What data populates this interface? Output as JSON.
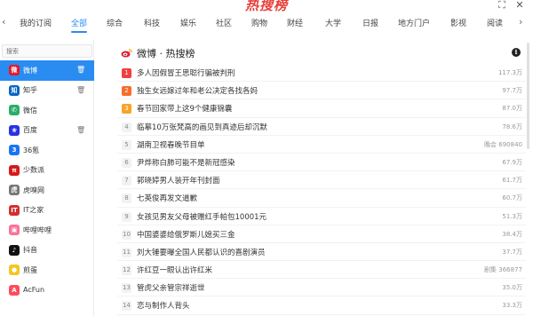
{
  "app": {
    "title": "热搜榜",
    "expand_icon": "⛶",
    "close_icon": "✕"
  },
  "tabs": {
    "prev_icon": "‹",
    "next_icon": "›",
    "items": [
      "我的订阅",
      "全部",
      "综合",
      "科技",
      "娱乐",
      "社区",
      "购物",
      "财经",
      "大学",
      "日报",
      "地方门户",
      "影视",
      "阅读"
    ],
    "active": "全部"
  },
  "sidebar": {
    "search_placeholder": "搜索",
    "items": [
      {
        "label": "微博",
        "icon": "weibo-icon",
        "glyph": "微",
        "color": "#e6162d",
        "active": true,
        "deletable": true
      },
      {
        "label": "知乎",
        "icon": "zhihu-icon",
        "glyph": "知",
        "color": "#0a66c2",
        "active": false,
        "deletable": true
      },
      {
        "label": "微信",
        "icon": "wechat-icon",
        "glyph": "✆",
        "color": "#2aae67",
        "active": false,
        "deletable": false
      },
      {
        "label": "百度",
        "icon": "baidu-icon",
        "glyph": "❀",
        "color": "#2932e1",
        "active": false,
        "deletable": true
      },
      {
        "label": "36氪",
        "icon": "36kr-icon",
        "glyph": "3",
        "color": "#1976f2",
        "active": false,
        "deletable": false
      },
      {
        "label": "少数派",
        "icon": "sspai-icon",
        "glyph": "π",
        "color": "#d71a1b",
        "active": false,
        "deletable": false
      },
      {
        "label": "虎嗅网",
        "icon": "huxiu-icon",
        "glyph": "虎",
        "color": "#777777",
        "active": false,
        "deletable": false
      },
      {
        "label": "IT之家",
        "icon": "ithome-icon",
        "glyph": "IT",
        "color": "#d32f2f",
        "active": false,
        "deletable": false
      },
      {
        "label": "哔哩哔哩",
        "icon": "bilibili-icon",
        "glyph": "▣",
        "color": "#fb7299",
        "active": false,
        "deletable": false
      },
      {
        "label": "抖音",
        "icon": "douyin-icon",
        "glyph": "♪",
        "color": "#111111",
        "active": false,
        "deletable": false
      },
      {
        "label": "煎蛋",
        "icon": "jandan-icon",
        "glyph": "●",
        "color": "#f3c623",
        "active": false,
        "deletable": false
      },
      {
        "label": "AcFun",
        "icon": "acfun-icon",
        "glyph": "A",
        "color": "#fd4c5d",
        "active": false,
        "deletable": false
      }
    ],
    "delete_icon": "🗑"
  },
  "main": {
    "title": "微博 · 热搜榜",
    "info_icon": "i",
    "accent_colors": {
      "rank1": "#f0413f",
      "rank2": "#f76d2b",
      "rank3": "#f8a426",
      "active": "#2a8cf0"
    },
    "items": [
      {
        "rank": "1",
        "title": "多人因假冒王思聪行骗被判刑",
        "value": "117.3万"
      },
      {
        "rank": "2",
        "title": "独生女远嫁过年和老公决定各找各妈",
        "value": "97.7万"
      },
      {
        "rank": "3",
        "title": "春节回家带上这9个健康锦囊",
        "value": "87.0万"
      },
      {
        "rank": "4",
        "title": "临摹10万张梵高的画见到真迹后却沉默",
        "value": "78.6万"
      },
      {
        "rank": "5",
        "title": "湖南卫视春晚节目单",
        "value": "晚会 690840"
      },
      {
        "rank": "6",
        "title": "尹烨称白肺可能不是新冠感染",
        "value": "67.9万"
      },
      {
        "rank": "7",
        "title": "郭晓婷男人装开年刊封面",
        "value": "61.7万"
      },
      {
        "rank": "8",
        "title": "七英俊再发文道歉",
        "value": "60.7万"
      },
      {
        "rank": "9",
        "title": "女孩见男友父母被赠红手帕包10001元",
        "value": "51.3万"
      },
      {
        "rank": "10",
        "title": "中国婆婆给俄罗斯儿媳买三金",
        "value": "38.4万"
      },
      {
        "rank": "11",
        "title": "刘大锤要曝全国人民都认识的喜剧演员",
        "value": "37.7万"
      },
      {
        "rank": "12",
        "title": "许红豆一眼认出许红米",
        "value": "剧集 366877"
      },
      {
        "rank": "13",
        "title": "管虎父亲管宗祥逝世",
        "value": "35.0万"
      },
      {
        "rank": "14",
        "title": "恋与制作人背头",
        "value": "33.3万"
      }
    ]
  }
}
